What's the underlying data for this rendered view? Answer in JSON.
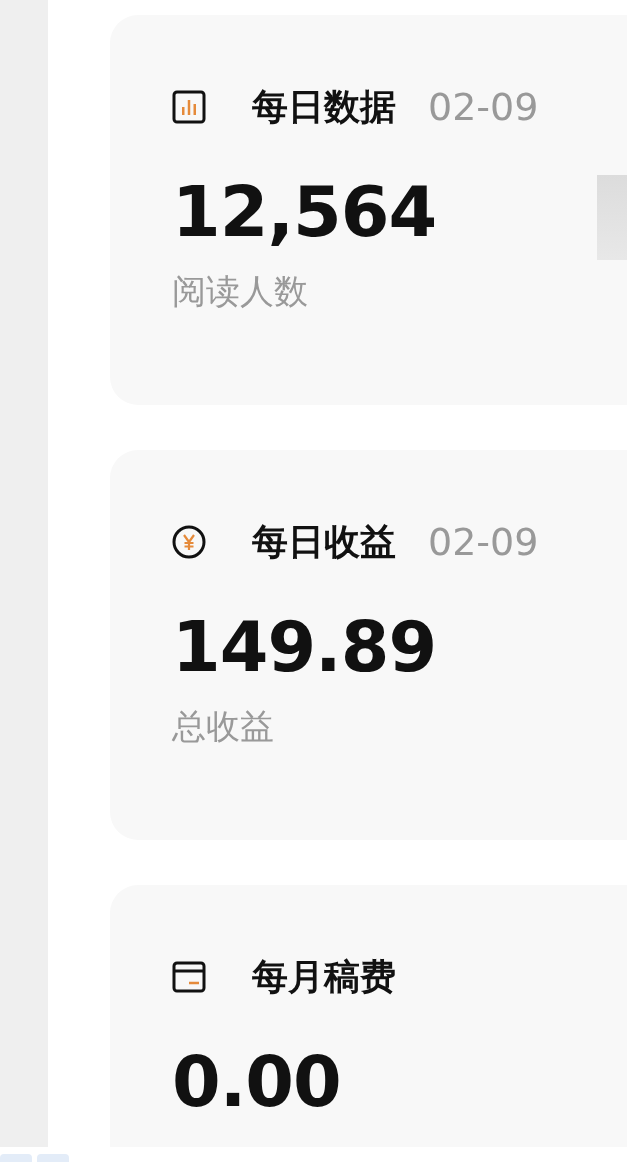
{
  "cards": [
    {
      "kind": "bars",
      "title": "每日数据",
      "date": "02-09",
      "value": "12,564",
      "caption": "阅读人数"
    },
    {
      "kind": "yen",
      "title": "每日收益",
      "date": "02-09",
      "value": "149.89",
      "caption": "总收益"
    },
    {
      "kind": "wallet",
      "title": "每月稿费",
      "value": "0.00"
    }
  ]
}
